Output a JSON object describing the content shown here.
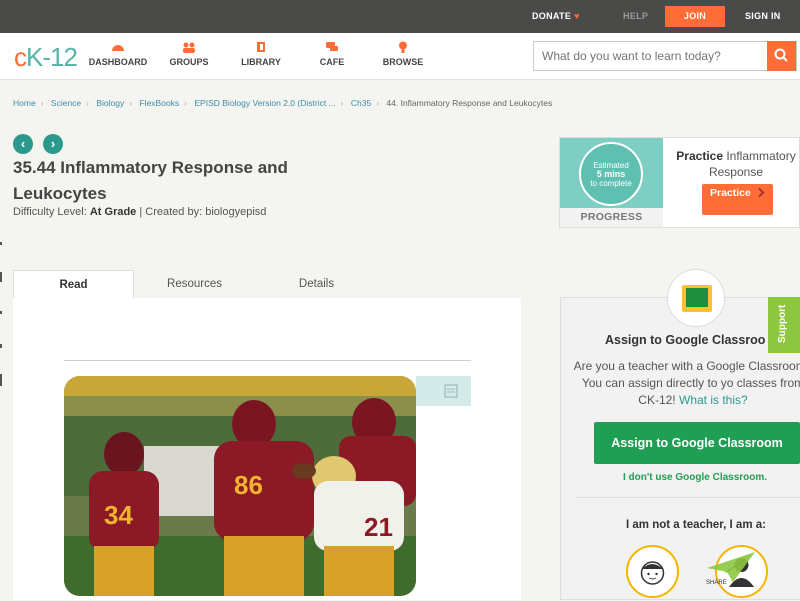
{
  "topbar": {
    "donate": "DONATE",
    "help": "HELP",
    "join": "JOIN",
    "signin": "SIGN IN"
  },
  "logo": {
    "text_c": "c",
    "text_rest": "K-12"
  },
  "nav": {
    "items": [
      {
        "label": "DASHBOARD",
        "icon": "dashboard-icon"
      },
      {
        "label": "GROUPS",
        "icon": "groups-icon"
      },
      {
        "label": "LIBRARY",
        "icon": "library-icon"
      },
      {
        "label": "CAFE",
        "icon": "cafe-icon"
      },
      {
        "label": "BROWSE",
        "icon": "browse-icon"
      }
    ]
  },
  "search": {
    "placeholder": "What do you want to learn today?"
  },
  "breadcrumb": {
    "items": [
      "Home",
      "Science",
      "Biology",
      "FlexBooks",
      "EPISD Biology Version 2.0 (District ...",
      "Ch35"
    ],
    "current": "44. Inflammatory Response and Leukocytes"
  },
  "article": {
    "title": "35.44 Inflammatory Response and Leukocytes",
    "difficulty_label": "Difficulty Level:",
    "difficulty": "At Grade",
    "created_label": "| Created by:",
    "author": "biologyepisd",
    "prev_arrow": "‹",
    "next_arrow": "›"
  },
  "tabs": [
    "Read",
    "Resources",
    "Details"
  ],
  "practice": {
    "estimate_line1": "Estimated",
    "estimate_line2": "5 mins",
    "estimate_line3": "to complete",
    "progress_label": "PROGRESS",
    "title_bold": "Practice",
    "title_rest": "Inflammatory Response",
    "button": "Practice"
  },
  "google_classroom": {
    "title": "Assign to Google Classroo",
    "desc": "Are you a teacher with a Google Classroom? You can assign directly to yo classes from CK-12!",
    "what_link": "What is this?",
    "button": "Assign to Google Classroom",
    "dont_use": "I don't use Google Classroom.",
    "not_teacher": "I am not a teacher, I am a:"
  },
  "support": {
    "label": "Support"
  },
  "share": {
    "label": "SHARE"
  },
  "colors": {
    "accent": "#ff6d36",
    "teal": "#2b9a8c",
    "green": "#1e9f53",
    "support": "#8dc63f"
  }
}
